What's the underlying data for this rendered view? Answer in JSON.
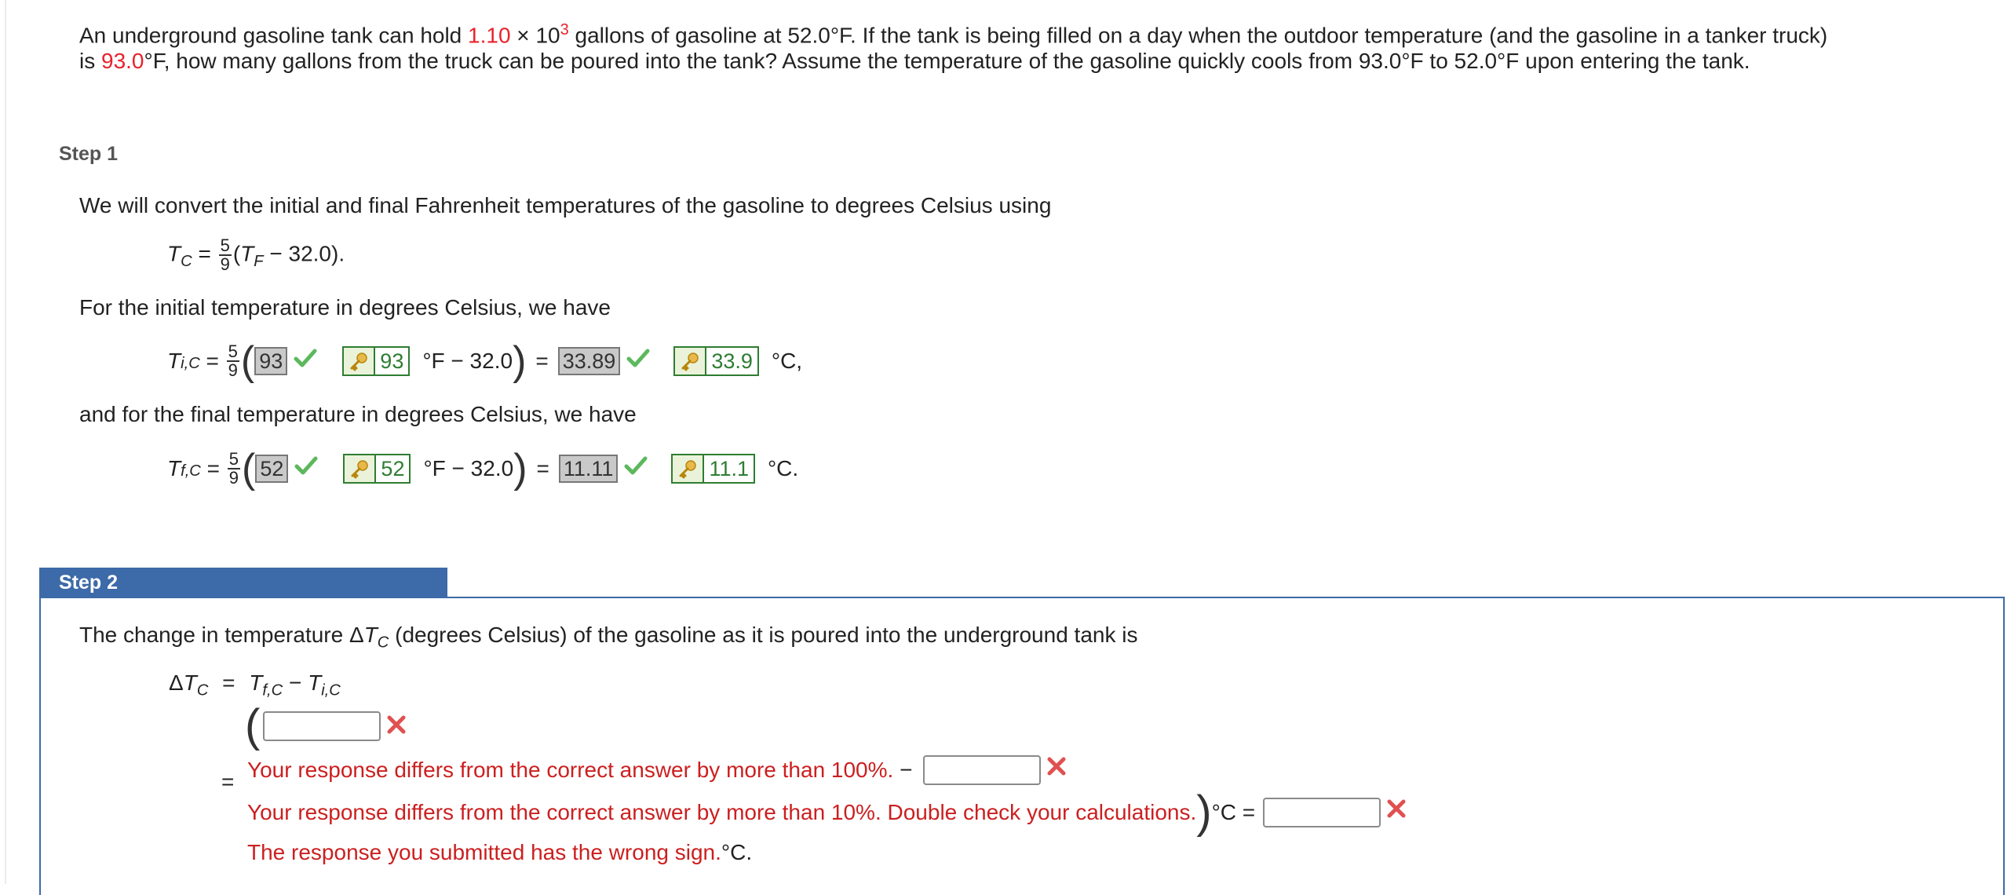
{
  "problem": {
    "part1": "An underground gasoline tank can hold ",
    "capacity_mantissa": "1.10",
    "times": " × 10",
    "exponent": "3",
    "part2": " gallons of gasoline at 52.0°F. If the tank is being filled on a day when the outdoor temperature (and the gasoline in a tanker truck)",
    "line2_prefix": "is ",
    "truck_temp": "93.0",
    "line2_rest": "°F, how many gallons from the truck can be poured into the tank? Assume the temperature of the gasoline quickly cools from 93.0°F to 52.0°F upon entering the tank."
  },
  "step1": {
    "label": "Step 1",
    "intro": "We will convert the initial and final Fahrenheit temperatures of the gasoline to degrees Celsius using",
    "formula": {
      "lhs": "T",
      "lhs_sub": "C",
      "eq": " = ",
      "frac_num": "5",
      "frac_den": "9",
      "paren_open": "(",
      "var": "T",
      "var_sub": "F",
      "rest": " − 32.0)."
    },
    "initial_text": "For the initial temperature in degrees Celsius, we have",
    "initial": {
      "lhs": "T",
      "lhs_sub": "i,C",
      "eq": " = ",
      "frac_num": "5",
      "frac_den": "9",
      "submitted_f": "93",
      "key_f": "93",
      "unit_f": "°F − 32.0",
      "eq2": "=",
      "submitted_c": "33.89",
      "key_c": "33.9",
      "unit_c": "°C,"
    },
    "final_text": "and for the final temperature in degrees Celsius, we have",
    "final": {
      "lhs": "T",
      "lhs_sub": "f,C",
      "eq": " = ",
      "frac_num": "5",
      "frac_den": "9",
      "submitted_f": "52",
      "key_f": "52",
      "unit_f": "°F − 32.0",
      "eq2": "=",
      "submitted_c": "11.11",
      "key_c": "11.1",
      "unit_c": "°C."
    }
  },
  "step2": {
    "label": "Step 2",
    "intro_a": "The change in temperature Δ",
    "intro_var": "T",
    "intro_sub": "C",
    "intro_b": " (degrees Celsius) of the gasoline as it is poured into the underground tank is",
    "eq_lhs": "Δ",
    "eq_lhs_var": "T",
    "eq_lhs_sub": "C",
    "eq_sign": "=",
    "eq_rhs_a": "T",
    "eq_rhs_a_sub": "f,C",
    "eq_minus": " − ",
    "eq_rhs_b": "T",
    "eq_rhs_b_sub": "i,C",
    "second_eq": "=",
    "err1": "Your response differs from the correct answer by more than 100%.",
    "minus": " − ",
    "err2": "Your response differs from the correct answer by more than 10%. Double check your calculations.",
    "close_paren_unit": "°C =",
    "err3": "The response you submitted has the wrong sign.",
    "err3_unit": "°C."
  },
  "colors": {
    "highlight_red": "#e8222b",
    "error_red": "#cc1f1f",
    "correct_green": "#2e7d32",
    "step_blue": "#3d6aa8"
  }
}
